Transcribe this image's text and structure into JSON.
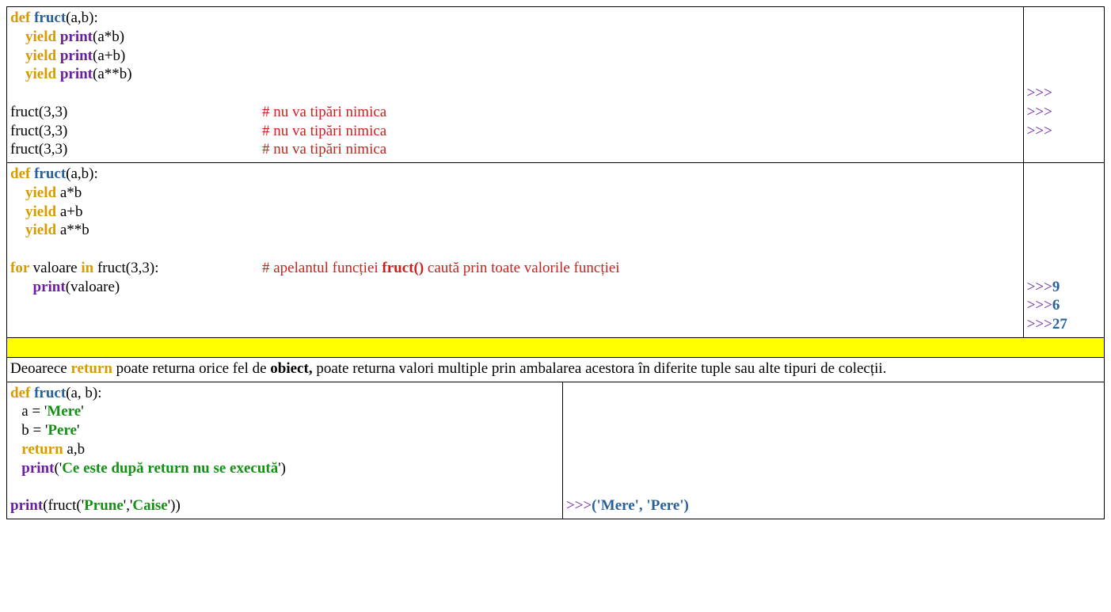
{
  "row1": {
    "code": {
      "l1": {
        "def": "def ",
        "fn": "fruct",
        "args": "(a,b):"
      },
      "l2": {
        "yield": "    yield ",
        "print": "print",
        "args": "(a*b)"
      },
      "l3": {
        "yield": "    yield ",
        "print": "print",
        "args": "(a+b)"
      },
      "l4": {
        "yield": "    yield ",
        "print": "print",
        "args": "(a**b)"
      },
      "blank": "",
      "l5": {
        "call": "fruct(3,3)",
        "cmt": "# nu va tipări nimica"
      },
      "l6": {
        "call": "fruct(3,3)",
        "cmt": "# nu va tipări nimica"
      },
      "l7": {
        "call": "fruct(3,3)",
        "cmt": "# nu va tipări nimica"
      }
    },
    "out": {
      "l1": ">>>",
      "l2": ">>>",
      "l3": ">>>"
    }
  },
  "row2": {
    "code": {
      "l1": {
        "def": "def ",
        "fn": "fruct",
        "args": "(a,b):"
      },
      "l2": {
        "yield": "    yield ",
        "expr": "a*b"
      },
      "l3": {
        "yield": "    yield ",
        "expr": "a+b"
      },
      "l4": {
        "yield": "    yield ",
        "expr": "a**b"
      },
      "blank": "",
      "l5": {
        "for": "for ",
        "var": "valoare ",
        "in": "in ",
        "call": "fruct(3,3):",
        "cmt_pre": "# apelantul funcției ",
        "cmt_fn": "fruct()",
        "cmt_post": " caută prin toate valorile funcției"
      },
      "l6": {
        "indent": "      ",
        "print": "print",
        "args": "(valoare)"
      }
    },
    "out": {
      "l1p": ">>>",
      "l1v": "9",
      "l2p": ">>>",
      "l2v": "6",
      "l3p": ">>>",
      "l3v": "27"
    }
  },
  "para": {
    "t1": "Deoarece ",
    "ret": "return",
    "t2": " poate returna orice fel de ",
    "obj": "obiect,",
    "t3": " poate returna valori multiple prin ambalarea acestora în diferite tuple sau alte tipuri de colecții."
  },
  "row4": {
    "code": {
      "l1": {
        "def": "def ",
        "fn": "fruct",
        "args": "(a, b):"
      },
      "l2": {
        "indent": "   a = ",
        "q1": "'",
        "str": "Mere",
        "q2": "'"
      },
      "l3": {
        "indent": "   b = ",
        "q1": "'",
        "str": "Pere",
        "q2": "'"
      },
      "l4": {
        "indent": "   ",
        "ret": "return ",
        "expr": "a,b"
      },
      "l5": {
        "indent": "   ",
        "print": "print",
        "open": "(",
        "q1": "'",
        "str": "Ce este după return nu se execută",
        "q2": "'",
        "close": ")"
      },
      "blank": "",
      "l6": {
        "print": "print",
        "open": "(fruct(",
        "q1a": "'",
        "s1": "Prune",
        "q1b": "'",
        "comma": ",",
        "q2a": "'",
        "s2": "Caise",
        "q2b": "'",
        "close": "))"
      }
    },
    "out": {
      "prompt": ">>>",
      "val": "('Mere', 'Pere')"
    }
  }
}
